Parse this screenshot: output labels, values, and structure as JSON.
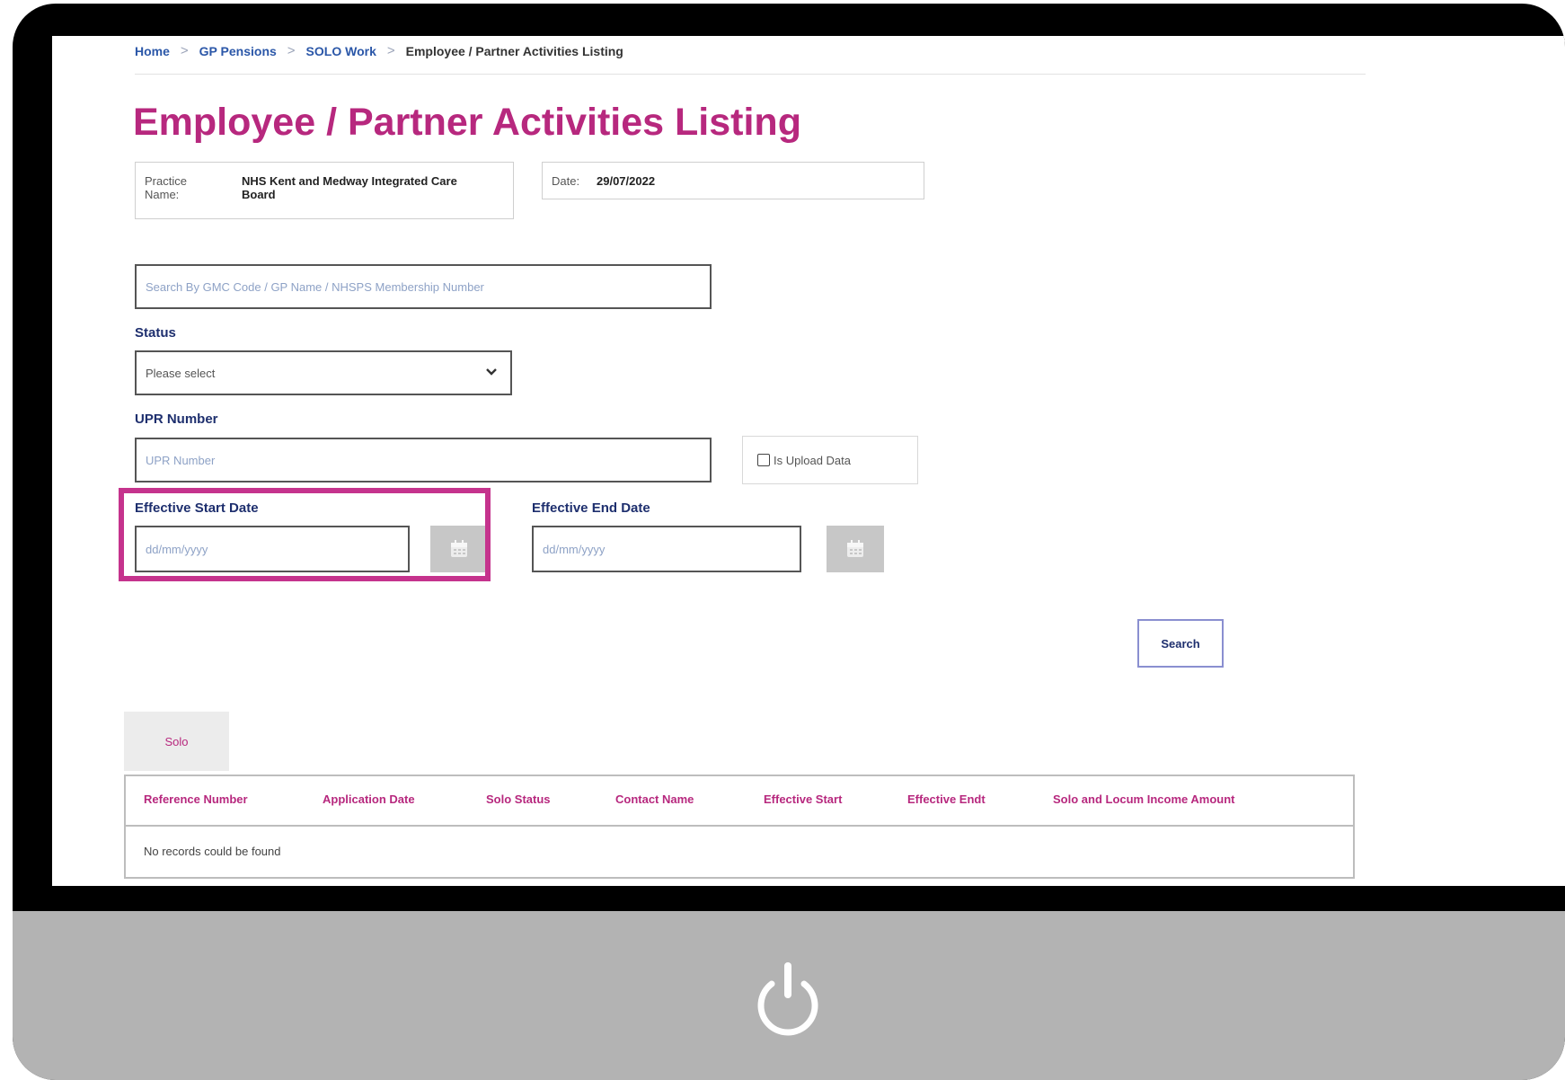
{
  "breadcrumb": [
    "Home",
    "GP Pensions",
    "SOLO Work",
    "Employee / Partner Activities Listing"
  ],
  "page_title": "Employee / Partner Activities Listing",
  "practice": {
    "label": "Practice Name:",
    "value": "NHS Kent and Medway Integrated Care Board"
  },
  "date": {
    "label": "Date:",
    "value": "29/07/2022"
  },
  "search": {
    "placeholder": "Search By GMC Code / GP Name / NHSPS Membership Number"
  },
  "status": {
    "label": "Status",
    "selected": "Please select"
  },
  "upr": {
    "label": "UPR Number",
    "placeholder": "UPR Number",
    "upload_checkbox_label": "Is Upload Data"
  },
  "effective_start": {
    "label": "Effective Start Date",
    "placeholder": "dd/mm/yyyy"
  },
  "effective_end": {
    "label": "Effective End Date",
    "placeholder": "dd/mm/yyyy"
  },
  "search_button": "Search",
  "tabs": [
    "Solo"
  ],
  "table": {
    "columns": [
      "Reference Number",
      "Application Date",
      "Solo Status",
      "Contact Name",
      "Effective Start",
      "Effective Endt",
      "Solo and Locum Income Amount"
    ],
    "empty_message": "No records could be found"
  },
  "colors": {
    "accent": "#b7287e",
    "highlight": "#c5338d",
    "navy": "#1e2f6e",
    "monitor_bezel": "#000000",
    "monitor_chin": "#b3b3b3"
  }
}
